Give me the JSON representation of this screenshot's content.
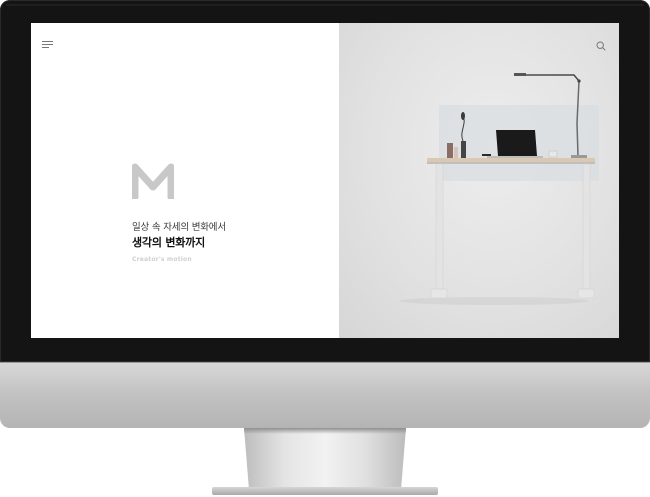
{
  "hero": {
    "subtitle": "일상 속 자세의 변화에서",
    "headline": "생각의 변화까지",
    "tagline": "Creator's motion"
  },
  "icons": {
    "menu": "hamburger-menu-icon",
    "search": "search-icon",
    "logo": "m-logo-icon"
  },
  "colors": {
    "screen_left_bg": "#ffffff",
    "screen_right_bg": "#e2e2e2",
    "bezel": "#141414",
    "logo": "#c8c8c8"
  }
}
